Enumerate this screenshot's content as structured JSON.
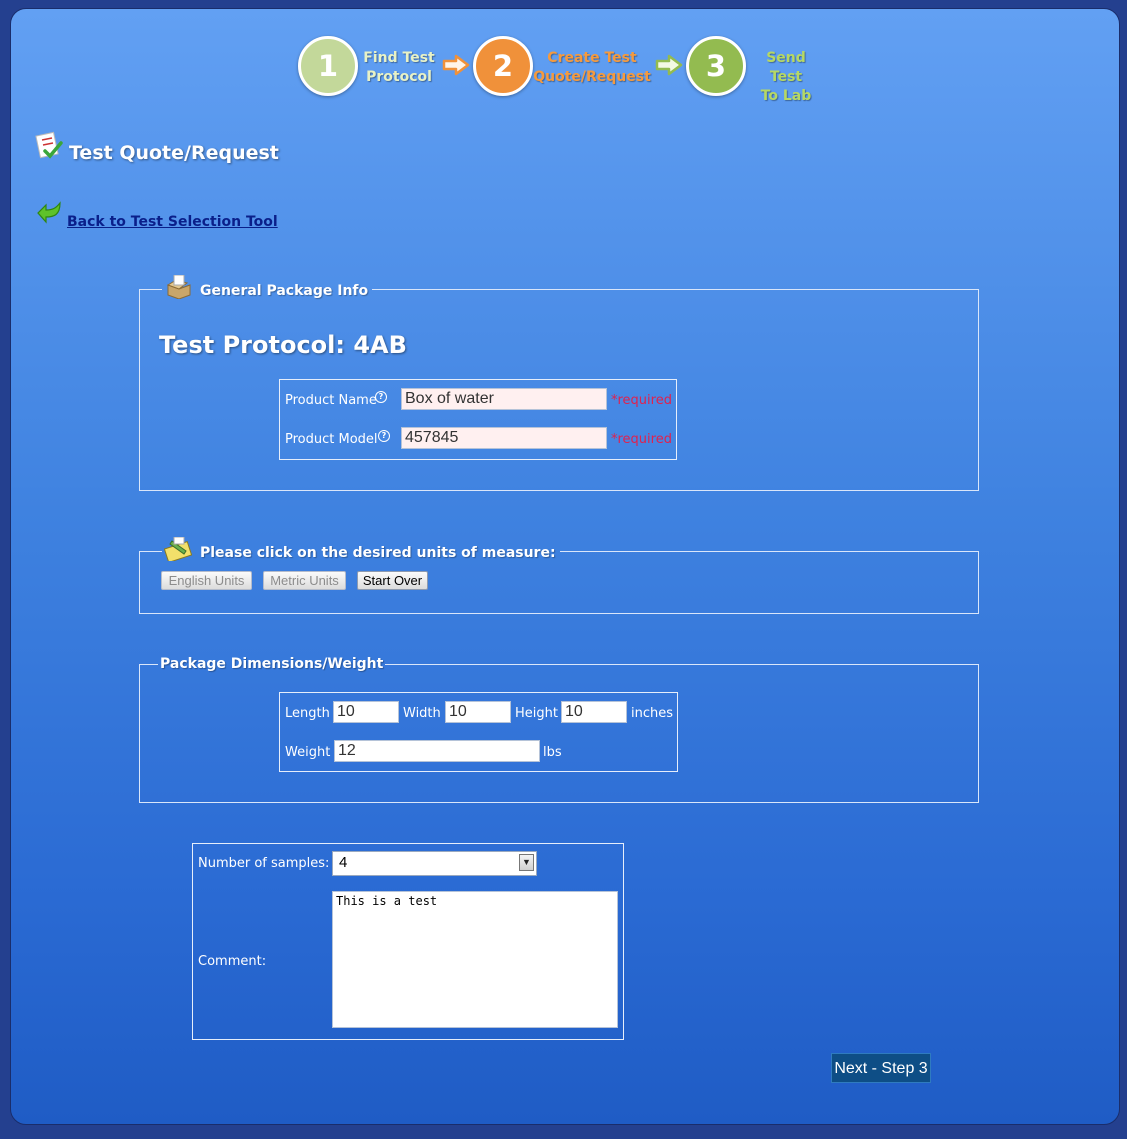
{
  "steps": [
    {
      "number": "1",
      "label_line1": "Find Test",
      "label_line2": "Protocol",
      "color": "#c3d89a",
      "label_color": "#e8f2c6"
    },
    {
      "number": "2",
      "label_line1": "Create Test",
      "label_line2": "Quote/Request",
      "color": "#f0913a",
      "label_color": "#f59a3e"
    },
    {
      "number": "3",
      "label_line1": "Send Test",
      "label_line2": "To Lab",
      "color": "#93bb50",
      "label_color": "#b6d864"
    }
  ],
  "page_title": "Test Quote/Request",
  "back_link": "Back to Test Selection Tool",
  "general": {
    "legend": "General Package Info",
    "protocol_heading": "Test Protocol: 4AB",
    "product_name_label": "Product Name",
    "product_name_value": "Box of water",
    "product_model_label": "Product Model",
    "product_model_value": "457845",
    "required_text": "*required",
    "help_icon": "?"
  },
  "units": {
    "legend": "Please click on the desired units of measure:",
    "english_button": "English Units",
    "metric_button": "Metric Units",
    "start_over_button": "Start Over"
  },
  "dimensions": {
    "legend": "Package Dimensions/Weight",
    "length_label": "Length",
    "length_value": "10",
    "width_label": "Width",
    "width_value": "10",
    "height_label": "Height",
    "height_value": "10",
    "dim_unit": "inches",
    "weight_label": "Weight",
    "weight_value": "12",
    "weight_unit": "lbs"
  },
  "samples": {
    "label": "Number of samples:",
    "selected": "4",
    "dropdown_arrow": "▼"
  },
  "comment": {
    "label": "Comment:",
    "value": "This is a test"
  },
  "next_button": "Next - Step 3"
}
